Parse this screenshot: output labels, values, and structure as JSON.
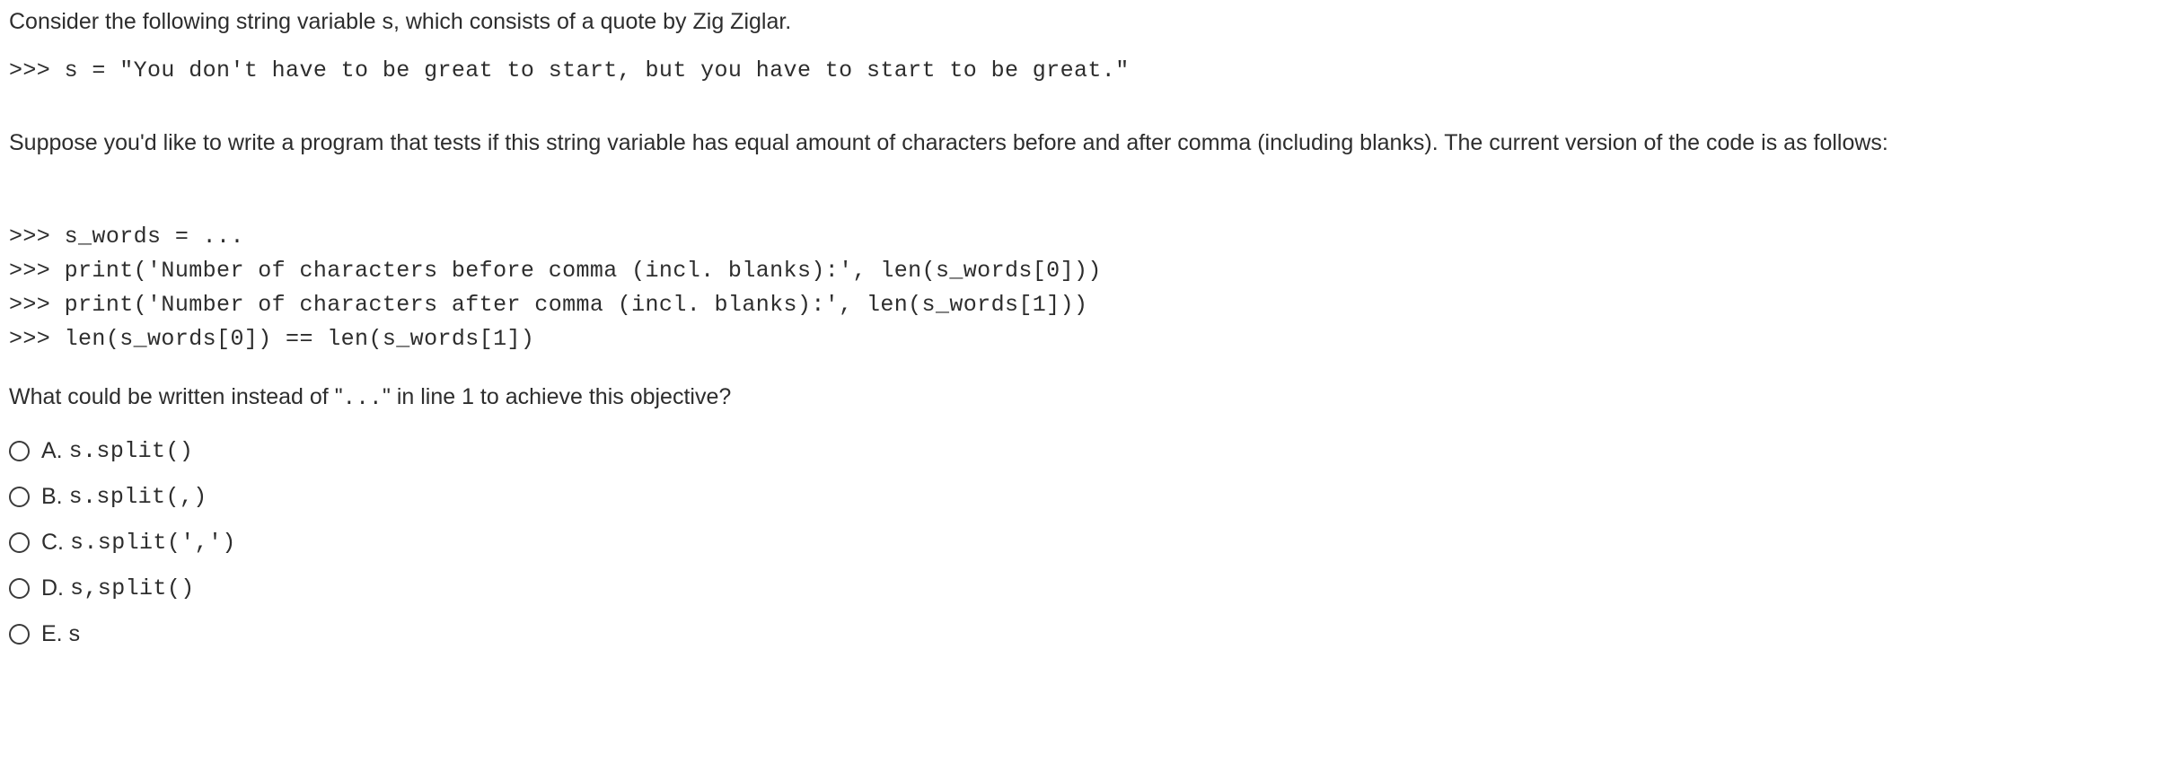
{
  "question": {
    "intro": "Consider the following string variable s, which consists of a quote by Zig Ziglar.",
    "code_block_1": [
      ">>> s = \"You don't have to be great to start, but you have to start to be great.\""
    ],
    "paragraph_2": "Suppose you'd like to write a program that tests if this string variable has equal amount of characters before and after comma (including blanks). The current version of the code is as follows:",
    "code_block_2": [
      ">>> s_words = ...",
      ">>> print('Number of characters before comma (incl. blanks):', len(s_words[0]))",
      ">>> print('Number of characters after comma (incl. blanks):', len(s_words[1]))",
      ">>> len(s_words[0]) == len(s_words[1])"
    ],
    "prompt_prefix": "What could be written instead of \"",
    "prompt_ellipsis": "...",
    "prompt_suffix": "\" in line 1 to achieve this objective?"
  },
  "options": [
    {
      "letter": "A.",
      "code": "s.split()",
      "plain": "",
      "is_code": true,
      "selected": false
    },
    {
      "letter": "B.",
      "code": "s.split(,)",
      "plain": "",
      "is_code": true,
      "selected": false
    },
    {
      "letter": "C.",
      "code": "s.split(',')",
      "plain": "",
      "is_code": true,
      "selected": false
    },
    {
      "letter": "D.",
      "code": "s,split()",
      "plain": "",
      "is_code": true,
      "selected": false
    },
    {
      "letter": "E.",
      "code": "",
      "plain": "s",
      "is_code": false,
      "selected": false
    }
  ],
  "colors": {
    "text": "#2d2d2d",
    "background": "#ffffff",
    "radio_border": "#3a3a3a"
  }
}
